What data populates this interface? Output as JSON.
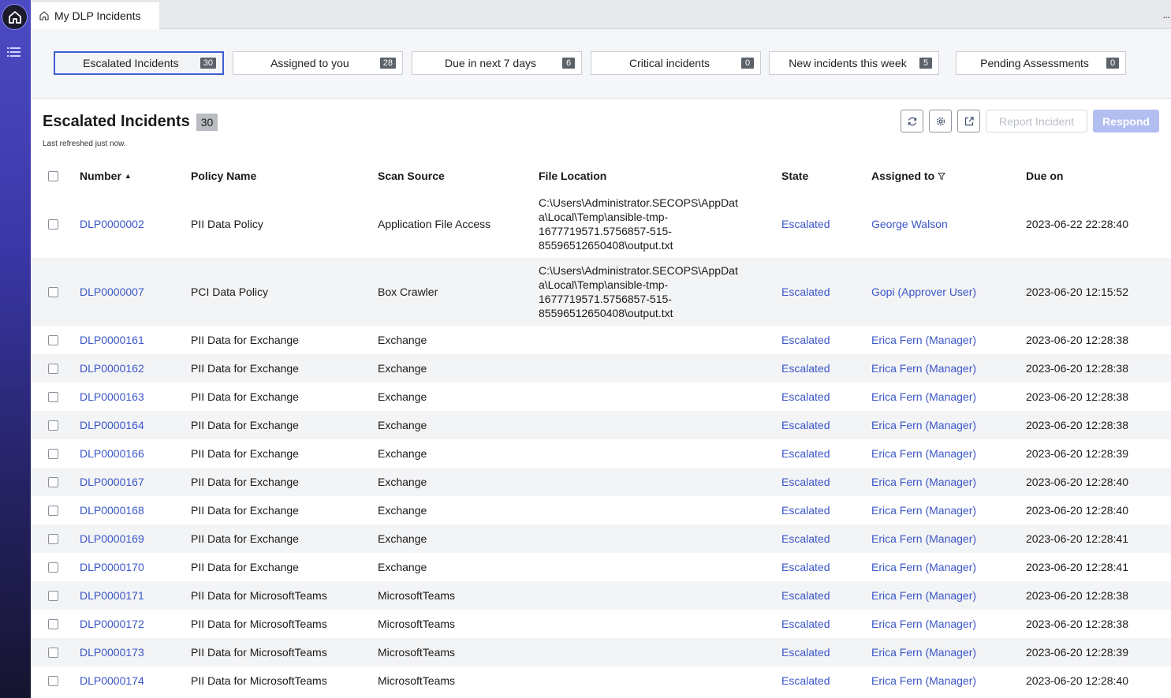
{
  "app": {
    "tab_title": "My DLP Incidents",
    "more_label": "..."
  },
  "filters": [
    {
      "label": "Escalated Incidents",
      "count": "30",
      "active": true
    },
    {
      "label": "Assigned to you",
      "count": "28",
      "active": false
    },
    {
      "label": "Due in next 7 days",
      "count": "6",
      "active": false
    },
    {
      "label": "Critical incidents",
      "count": "0",
      "active": false
    },
    {
      "label": "New incidents this week",
      "count": "5",
      "active": false
    },
    {
      "label": "Pending Assessments",
      "count": "0",
      "active": false
    }
  ],
  "list": {
    "title": "Escalated Incidents",
    "count": "30",
    "refreshed": "Last refreshed just now.",
    "report_label": "Report Incident",
    "respond_label": "Respond",
    "toolbar_icons": [
      "refresh-icon",
      "gear-icon",
      "export-icon"
    ]
  },
  "columns": {
    "number": "Number",
    "policy": "Policy Name",
    "source": "Scan Source",
    "location": "File Location",
    "state": "State",
    "assigned": "Assigned to",
    "due": "Due on"
  },
  "rows": [
    {
      "number": "DLP0000002",
      "policy": "PII Data Policy",
      "source": "Application File Access",
      "location": "C:\\Users\\Administrator.SECOPS\\AppDat\na\\Local\\Temp\\ansible-tmp-\n1677719571.5756857-515-\n85596512650408\\output.txt",
      "state": "Escalated",
      "assigned": "George Walson",
      "due": "2023-06-22 22:28:40"
    },
    {
      "number": "DLP0000007",
      "policy": "PCI Data Policy",
      "source": "Box Crawler",
      "location": "C:\\Users\\Administrator.SECOPS\\AppDat\na\\Local\\Temp\\ansible-tmp-\n1677719571.5756857-515-\n85596512650408\\output.txt",
      "state": "Escalated",
      "assigned": "Gopi  (Approver User)",
      "due": "2023-06-20 12:15:52"
    },
    {
      "number": "DLP0000161",
      "policy": "PII Data for Exchange",
      "source": "Exchange",
      "location": "",
      "state": "Escalated",
      "assigned": "Erica Fern (Manager)",
      "due": "2023-06-20 12:28:38"
    },
    {
      "number": "DLP0000162",
      "policy": "PII Data for Exchange",
      "source": "Exchange",
      "location": "",
      "state": "Escalated",
      "assigned": "Erica Fern (Manager)",
      "due": "2023-06-20 12:28:38"
    },
    {
      "number": "DLP0000163",
      "policy": "PII Data for Exchange",
      "source": "Exchange",
      "location": "",
      "state": "Escalated",
      "assigned": "Erica Fern (Manager)",
      "due": "2023-06-20 12:28:38"
    },
    {
      "number": "DLP0000164",
      "policy": "PII Data for Exchange",
      "source": "Exchange",
      "location": "",
      "state": "Escalated",
      "assigned": "Erica Fern (Manager)",
      "due": "2023-06-20 12:28:38"
    },
    {
      "number": "DLP0000166",
      "policy": "PII Data for Exchange",
      "source": "Exchange",
      "location": "",
      "state": "Escalated",
      "assigned": "Erica Fern (Manager)",
      "due": "2023-06-20 12:28:39"
    },
    {
      "number": "DLP0000167",
      "policy": "PII Data for Exchange",
      "source": "Exchange",
      "location": "",
      "state": "Escalated",
      "assigned": "Erica Fern (Manager)",
      "due": "2023-06-20 12:28:40"
    },
    {
      "number": "DLP0000168",
      "policy": "PII Data for Exchange",
      "source": "Exchange",
      "location": "",
      "state": "Escalated",
      "assigned": "Erica Fern (Manager)",
      "due": "2023-06-20 12:28:40"
    },
    {
      "number": "DLP0000169",
      "policy": "PII Data for Exchange",
      "source": "Exchange",
      "location": "",
      "state": "Escalated",
      "assigned": "Erica Fern (Manager)",
      "due": "2023-06-20 12:28:41"
    },
    {
      "number": "DLP0000170",
      "policy": "PII Data for Exchange",
      "source": "Exchange",
      "location": "",
      "state": "Escalated",
      "assigned": "Erica Fern (Manager)",
      "due": "2023-06-20 12:28:41"
    },
    {
      "number": "DLP0000171",
      "policy": "PII Data for MicrosoftTeams",
      "source": "MicrosoftTeams",
      "location": "",
      "state": "Escalated",
      "assigned": "Erica Fern (Manager)",
      "due": "2023-06-20 12:28:38"
    },
    {
      "number": "DLP0000172",
      "policy": "PII Data for MicrosoftTeams",
      "source": "MicrosoftTeams",
      "location": "",
      "state": "Escalated",
      "assigned": "Erica Fern (Manager)",
      "due": "2023-06-20 12:28:38"
    },
    {
      "number": "DLP0000173",
      "policy": "PII Data for MicrosoftTeams",
      "source": "MicrosoftTeams",
      "location": "",
      "state": "Escalated",
      "assigned": "Erica Fern (Manager)",
      "due": "2023-06-20 12:28:39"
    },
    {
      "number": "DLP0000174",
      "policy": "PII Data for MicrosoftTeams",
      "source": "MicrosoftTeams",
      "location": "",
      "state": "Escalated",
      "assigned": "Erica Fern (Manager)",
      "due": "2023-06-20 12:28:40"
    }
  ],
  "colors": {
    "link": "#3a56c8",
    "active_card_border": "#3e5fd6",
    "rail_top": "#4d4bc3",
    "rail_bottom": "#15142f",
    "respond_bg": "#b2bdf0"
  }
}
